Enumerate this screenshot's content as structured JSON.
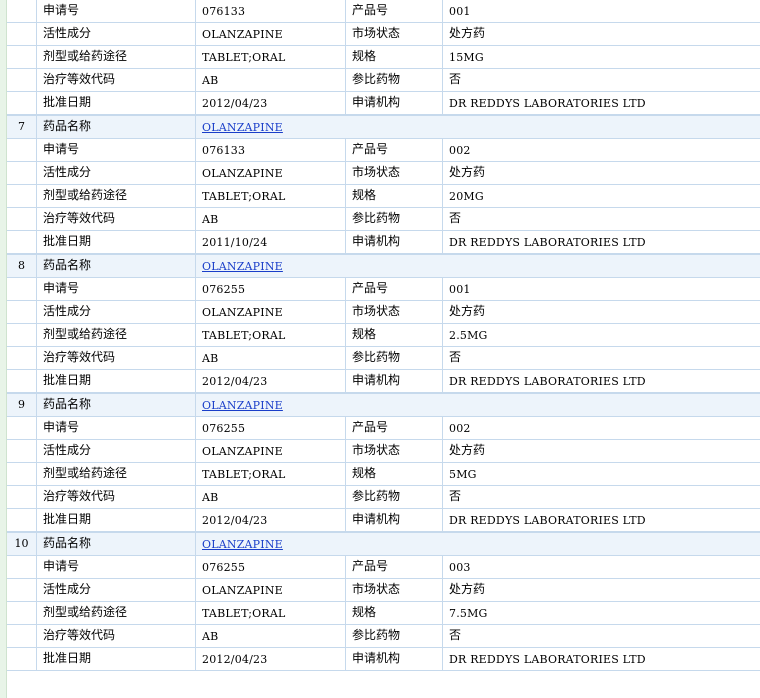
{
  "labels": {
    "drug_name": "药品名称",
    "application_no": "申请号",
    "product_no": "产品号",
    "active_ingredient": "活性成分",
    "market_status": "市场状态",
    "dosage_route": "剂型或给药途径",
    "strength": "规格",
    "te_code": "治疗等效代码",
    "reference_drug": "参比药物",
    "approval_date": "批准日期",
    "applicant": "申请机构"
  },
  "records": [
    {
      "index": "",
      "application_no": "076133",
      "product_no": "001",
      "active_ingredient": "OLANZAPINE",
      "market_status": "处方药",
      "dosage_route": "TABLET;ORAL",
      "strength": "15MG",
      "te_code": "AB",
      "reference_drug": "否",
      "approval_date": "2012/04/23",
      "applicant": "DR REDDYS LABORATORIES LTD"
    },
    {
      "index": "7",
      "drug_name": "OLANZAPINE",
      "application_no": "076133",
      "product_no": "002",
      "active_ingredient": "OLANZAPINE",
      "market_status": "处方药",
      "dosage_route": "TABLET;ORAL",
      "strength": "20MG",
      "te_code": "AB",
      "reference_drug": "否",
      "approval_date": "2011/10/24",
      "applicant": "DR REDDYS LABORATORIES LTD"
    },
    {
      "index": "8",
      "drug_name": "OLANZAPINE",
      "application_no": "076255",
      "product_no": "001",
      "active_ingredient": "OLANZAPINE",
      "market_status": "处方药",
      "dosage_route": "TABLET;ORAL",
      "strength": "2.5MG",
      "te_code": "AB",
      "reference_drug": "否",
      "approval_date": "2012/04/23",
      "applicant": "DR REDDYS LABORATORIES LTD"
    },
    {
      "index": "9",
      "drug_name": "OLANZAPINE",
      "application_no": "076255",
      "product_no": "002",
      "active_ingredient": "OLANZAPINE",
      "market_status": "处方药",
      "dosage_route": "TABLET;ORAL",
      "strength": "5MG",
      "te_code": "AB",
      "reference_drug": "否",
      "approval_date": "2012/04/23",
      "applicant": "DR REDDYS LABORATORIES LTD"
    },
    {
      "index": "10",
      "drug_name": "OLANZAPINE",
      "application_no": "076255",
      "product_no": "003",
      "active_ingredient": "OLANZAPINE",
      "market_status": "处方药",
      "dosage_route": "TABLET;ORAL",
      "strength": "7.5MG",
      "te_code": "AB",
      "reference_drug": "否",
      "approval_date": "2012/04/23",
      "applicant": "DR REDDYS LABORATORIES LTD"
    }
  ]
}
